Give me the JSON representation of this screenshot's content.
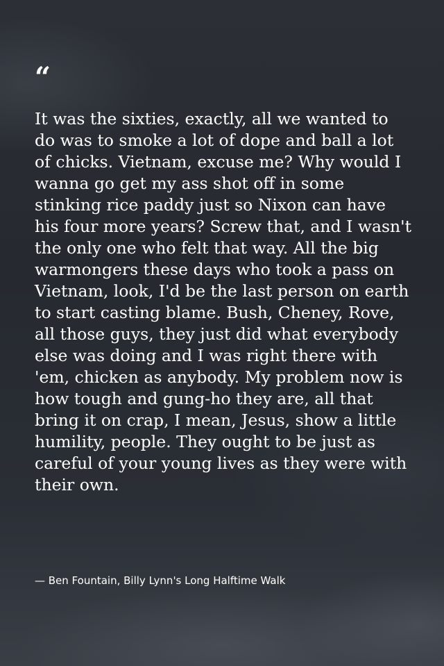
{
  "quote": {
    "mark": "“",
    "text": "It was the sixties, exactly, all we wanted to do was to smoke a lot of dope and ball a lot of chicks. Vietnam, excuse me? Why would I wanna go get my ass shot off in some stinking rice paddy just so Nixon can have his four more years? Screw that, and I wasn't the only one who felt that way. All the big warmongers these days who took a pass on Vietnam, look, I'd be the last person on earth to start casting blame. Bush, Cheney, Rove, all those guys, they just did what everybody else was doing and I was right there with 'em, chicken as anybody. My problem now is how tough and gung-ho they are, all that bring it on crap, I mean, Jesus, show a little humility, people. They ought to be just as careful of your young lives as they were with their own.",
    "attribution": "— Ben Fountain, Billy Lynn's Long Halftime Walk"
  },
  "colors": {
    "text": "#ffffff",
    "background": "#2a2e34"
  }
}
